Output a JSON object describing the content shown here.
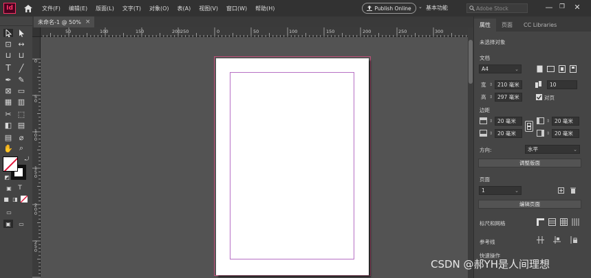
{
  "app": {
    "logo": "Id"
  },
  "menu": [
    "文件(F)",
    "编辑(E)",
    "版面(L)",
    "文字(T)",
    "对象(O)",
    "表(A)",
    "视图(V)",
    "窗口(W)",
    "帮助(H)"
  ],
  "publish_label": "Publish Online",
  "workspace_label": "基本功能",
  "search": {
    "placeholder": "Adobe Stock"
  },
  "document_tab": {
    "title": "未命名-1 @ 50%",
    "close": "×"
  },
  "ruler": {
    "h_labels": [
      "0",
      "50",
      "100",
      "150",
      "200",
      "250",
      "0",
      "50",
      "100",
      "150",
      "200",
      "250",
      "300"
    ],
    "v_labels": [
      "0",
      "50",
      "100",
      "150",
      "200",
      "250"
    ]
  },
  "panel": {
    "tabs": [
      "属性",
      "页面",
      "CC Libraries"
    ],
    "no_selection": "未选择对象",
    "document_heading": "文档",
    "page_size": "A4",
    "width_label": "宽",
    "width_value": "210 毫米",
    "height_label": "高",
    "height_value": "297 毫米",
    "pages_count": "10",
    "facing_pages_label": "对页",
    "margins_heading": "边距",
    "margin_top": "20 毫米",
    "margin_bottom": "20 毫米",
    "margin_left": "20 毫米",
    "margin_right": "20 毫米",
    "orientation_label": "方向:",
    "orientation_value": "水平",
    "adjust_layout_btn": "调整版面",
    "page_heading": "页面",
    "page_value": "1",
    "edit_page_btn": "编辑页面",
    "rulers_grids_label": "标尺和网格",
    "guides_label": "参考线",
    "quick_actions_label": "快速操作"
  },
  "watermark": "CSDN @郝YH是人间理想",
  "colors": {
    "accent": "#ff3366",
    "page_margin_guide": "#b66ec4",
    "page_bleed": "#c0507a"
  }
}
